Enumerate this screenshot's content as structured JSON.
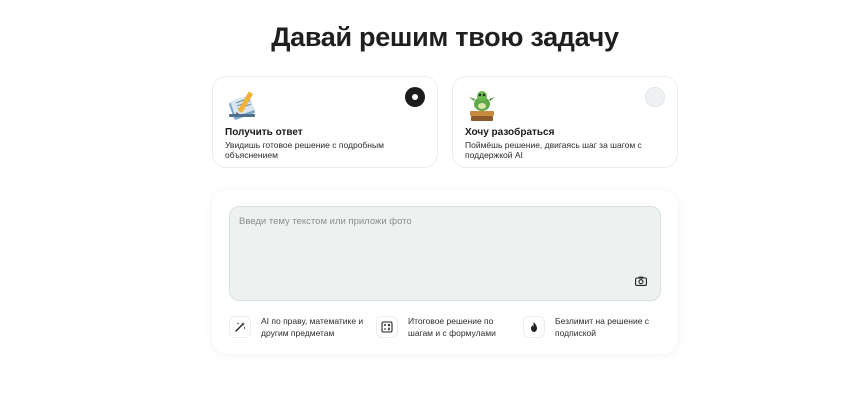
{
  "page_title": "Давай решим твою задачу",
  "modes": [
    {
      "title": "Получить ответ",
      "description": "Увидишь готовое решение с подробным объяснением",
      "icon": "notebook-pencil-icon",
      "selected": true
    },
    {
      "title": "Хочу разобраться",
      "description": "Поймёшь решение, двигаясь шаг за шагом с поддержкой AI",
      "icon": "dragon-on-books-icon",
      "selected": false
    }
  ],
  "input": {
    "placeholder": "Введи тему текстом или приложи фото",
    "value": "",
    "attach_icon": "camera-icon"
  },
  "features": [
    {
      "icon": "magic-wand-icon",
      "text": "AI по праву, математике и другим предметам"
    },
    {
      "icon": "formula-icon",
      "text": "Итоговое решение по шагам и с формулами"
    },
    {
      "icon": "flame-icon",
      "text": "Безлимит на решение с подпиской"
    }
  ]
}
